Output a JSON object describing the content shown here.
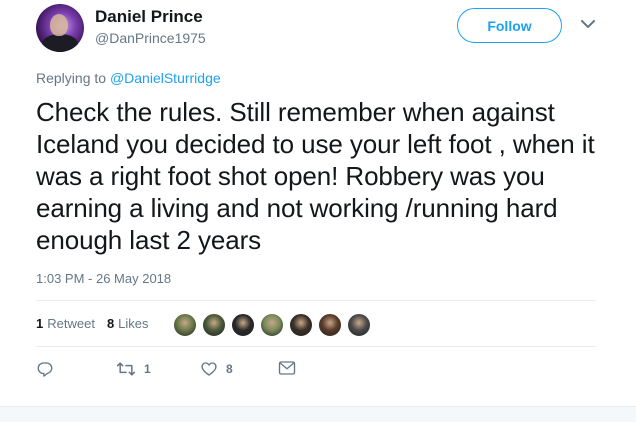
{
  "author": {
    "name": "Daniel Prince",
    "handle": "@DanPrince1975"
  },
  "follow_button": {
    "label": "Follow"
  },
  "caret_icon": "chevron-down-icon",
  "reply_context": {
    "prefix": "Replying to",
    "target": "@DanielSturridge"
  },
  "tweet": {
    "text": "Check the rules. Still remember when against Iceland you decided to use your left foot , when it was a right foot shot open! Robbery was you earning a living and not working /running hard enough last 2 years",
    "timestamp": "1:03 PM - 26 May 2018"
  },
  "stats": {
    "retweets_count": "1",
    "retweets_label": "Retweet",
    "likes_count": "8",
    "likes_label": "Likes"
  },
  "liker_avatars": [
    {
      "color": "#6b7a4a"
    },
    {
      "color": "#4a5a3a"
    },
    {
      "color": "#2a2a2a"
    },
    {
      "color": "#7a8a5a"
    },
    {
      "color": "#3a3028"
    },
    {
      "color": "#5a3a2a"
    },
    {
      "color": "#4a4a4a"
    }
  ],
  "actions": {
    "reply_icon": "reply-icon",
    "retweet_icon": "retweet-icon",
    "retweet_count": "1",
    "like_icon": "heart-icon",
    "like_count": "8",
    "dm_icon": "envelope-icon"
  },
  "colors": {
    "accent": "#1da1f2",
    "secondary_text": "#657786",
    "primary_text": "#14171a"
  }
}
